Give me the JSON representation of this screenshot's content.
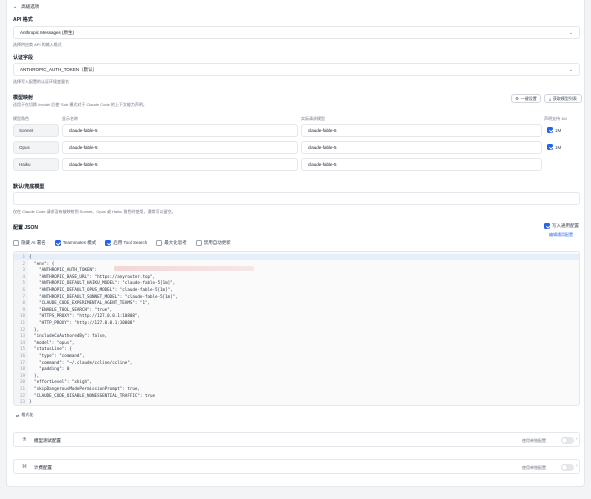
{
  "header": {
    "title": "高级选项"
  },
  "api_format": {
    "label": "API 格式",
    "value": "Anthropic Messages (原生)",
    "hint": "选择供应商 API 的输入格式"
  },
  "auth_field": {
    "label": "认证字段",
    "value": "ANTHROPIC_AUTH_TOKEN（默认）",
    "hint": "选择写入配置的认证环境变量名"
  },
  "model_mapping": {
    "title": "模型映射",
    "hint": "适用于在切换 /model 后使 'Sub 模式对于 Claude Code 的上下文能力声明。",
    "btn_oneclick": "一键设置",
    "btn_fetch": "获取模型列表",
    "headers": {
      "role": "模型角色",
      "display": "显示名称",
      "actual": "实际请求模型",
      "oneM": "声明支持 1M"
    },
    "rows": [
      {
        "role": "Sonnet",
        "display": "claude-fable-5",
        "actual": "claude-fable-5",
        "oneM_label": "1M",
        "oneM": true
      },
      {
        "role": "Opus",
        "display": "claude-fable-5",
        "actual": "claude-fable-5",
        "oneM_label": "1M",
        "oneM": true
      },
      {
        "role": "Haiku",
        "display": "claude-fable-5",
        "actual": "claude-fable-5"
      }
    ]
  },
  "default_model": {
    "label": "默认/兜底模型",
    "value": "",
    "hint": "仅在 Claude Code 请求没有被映射到 Sonnet、Opus 或 Haiku 角色时使用，通常可以留空。"
  },
  "config_json": {
    "title": "配置 JSON",
    "write_common": "写入通用配置",
    "edit_common": "编辑通用配置",
    "options": [
      {
        "label": "隐藏 AI 署名",
        "checked": false
      },
      {
        "label": "Teammates 模式",
        "checked": true
      },
      {
        "label": "启用 Tool Search",
        "checked": true
      },
      {
        "label": "最大化思考",
        "checked": false
      },
      {
        "label": "禁用自动更新",
        "checked": false
      }
    ],
    "lines": [
      {
        "n": "1",
        "t": "{"
      },
      {
        "n": "2",
        "t": "  \"env\": {"
      },
      {
        "n": "3",
        "t": "    \"ANTHROPIC_AUTH_TOKEN\": "
      },
      {
        "n": "4",
        "t": "    \"ANTHROPIC_BASE_URL\": \"https://anyrouter.top\","
      },
      {
        "n": "5",
        "t": "    \"ANTHROPIC_DEFAULT_HAIKU_MODEL\": \"claude-fable-5[1m]\","
      },
      {
        "n": "6",
        "t": "    \"ANTHROPIC_DEFAULT_OPUS_MODEL\": \"claude-fable-5[1m]\","
      },
      {
        "n": "7",
        "t": "    \"ANTHROPIC_DEFAULT_SONNET_MODEL\": \"claude-fable-5[1m]\","
      },
      {
        "n": "8",
        "t": "    \"CLAUDE_CODE_EXPERIMENTAL_AGENT_TEAMS\": \"1\","
      },
      {
        "n": "9",
        "t": "    \"ENABLE_TOOL_SEARCH\": \"true\","
      },
      {
        "n": "10",
        "t": "    \"HTTPS_PROXY\": \"http://127.0.0.1:10808\","
      },
      {
        "n": "11",
        "t": "    \"HTTP_PROXY\": \"http://127.0.0.1:10808\""
      },
      {
        "n": "12",
        "t": "  },"
      },
      {
        "n": "13",
        "t": "  \"includeCoAuthoredBy\": false,"
      },
      {
        "n": "14",
        "t": "  \"model\": \"opus\","
      },
      {
        "n": "15",
        "t": "  \"statusLine\": {"
      },
      {
        "n": "16",
        "t": "    \"type\": \"command\","
      },
      {
        "n": "17",
        "t": "    \"command\": \"~/.claude/ccline/ccline\","
      },
      {
        "n": "18",
        "t": "    \"padding\": 0"
      },
      {
        "n": "19",
        "t": "  },"
      },
      {
        "n": "20",
        "t": "  \"effortLevel\": \"xhigh\","
      },
      {
        "n": "21",
        "t": "  \"skipDangerousModePermissionPrompt\": true,"
      },
      {
        "n": "22",
        "t": "  \"CLAUDE_CODE_DISABLE_NONESSENTIAL_TRAFFIC\": true"
      },
      {
        "n": "23",
        "t": "}"
      }
    ],
    "format_btn": "格式化"
  },
  "sections": [
    {
      "title": "模型测试配置",
      "toggle_label": "使用单独配置"
    },
    {
      "title": "计费配置",
      "toggle_label": "使用单独配置"
    }
  ],
  "colors": {
    "accent": "#2563eb",
    "border": "#e5e7eb"
  }
}
